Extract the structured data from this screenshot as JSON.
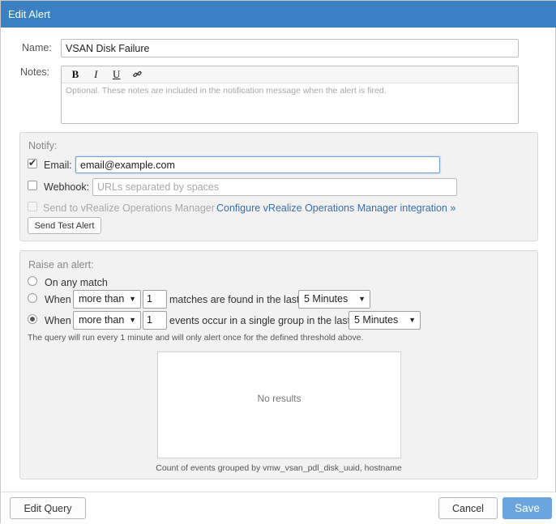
{
  "dialog": {
    "title": "Edit Alert"
  },
  "name": {
    "label": "Name:",
    "value": "VSAN Disk Failure"
  },
  "notes": {
    "label": "Notes:",
    "toolbar": {
      "bold": "B",
      "italic": "I",
      "underline": "U"
    },
    "placeholder": "Optional. These notes are included in the notification message when the alert is fired."
  },
  "notify": {
    "title": "Notify:",
    "email": {
      "label": "Email:",
      "checked": true,
      "value": "email@example.com"
    },
    "webhook": {
      "label": "Webhook:",
      "checked": false,
      "placeholder": "URLs separated by spaces"
    },
    "vrops": {
      "label": "Send to vRealize Operations Manager",
      "link": "Configure vRealize Operations Manager integration »",
      "enabled": false
    },
    "test_button": "Send Test Alert"
  },
  "raise": {
    "title": "Raise an alert:",
    "option_any": "On any match",
    "option_matches": {
      "when": "When",
      "comparator": "more than",
      "count": "1",
      "text": "matches are found in the last",
      "window": "5 Minutes"
    },
    "option_events": {
      "when": "When",
      "comparator": "more than",
      "count": "1",
      "text": "events occur in a single group in the last",
      "window": "5 Minutes"
    },
    "selected_option": "events",
    "note": "The query will run every 1 minute and will only alert once for the defined threshold above.",
    "results_empty": "No results",
    "caption": "Count of events grouped by vmw_vsan_pdl_disk_uuid, hostname"
  },
  "footer": {
    "edit_query": "Edit Query",
    "cancel": "Cancel",
    "save": "Save"
  },
  "colors": {
    "titlebar": "#3a80c3",
    "primary_button": "#6aa5df",
    "link": "#3a6ea8"
  }
}
